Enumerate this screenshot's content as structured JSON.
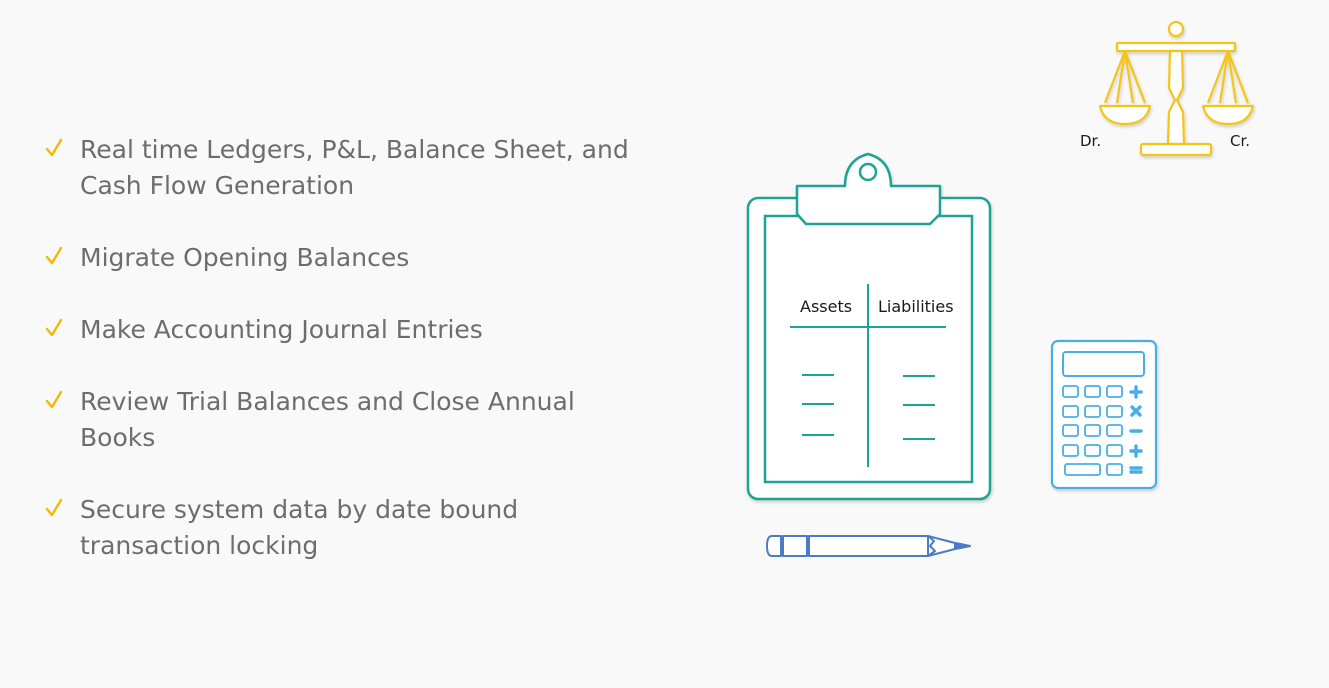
{
  "features": [
    {
      "text": "Real time Ledgers, P&L, Balance Sheet, and Cash Flow Generation",
      "lines": [
        "Real time Ledgers, P&L, Balance Sheet, and",
        "Cash Flow Generation"
      ]
    },
    {
      "text": "Migrate Opening Balances",
      "lines": [
        "Migrate Opening Balances"
      ]
    },
    {
      "text": "Make Accounting Journal Entries",
      "lines": [
        "Make Accounting Journal Entries"
      ]
    },
    {
      "text": "Review Trial Balances and Close Annual Books",
      "lines": [
        "Review Trial Balances and Close Annual",
        "Books"
      ]
    },
    {
      "text": "Secure system data by date bound transaction locking",
      "lines": [
        "Secure system data by date bound",
        "transaction locking"
      ]
    }
  ],
  "scale": {
    "debit_label": "Dr.",
    "credit_label": "Cr."
  },
  "clipboard": {
    "assets_label": "Assets",
    "liabilities_label": "Liabilities"
  },
  "icons": {
    "check": "check-icon",
    "scale": "balance-scale-icon",
    "clipboard": "clipboard-icon",
    "calculator": "calculator-icon",
    "pencil": "pencil-icon"
  },
  "colors": {
    "text": "#6d6d6d",
    "check": "#f5b800",
    "scale": "#f5c518",
    "clipboard": "#1fa394",
    "calculator": "#4aaee6",
    "pencil": "#4b7bc4"
  }
}
